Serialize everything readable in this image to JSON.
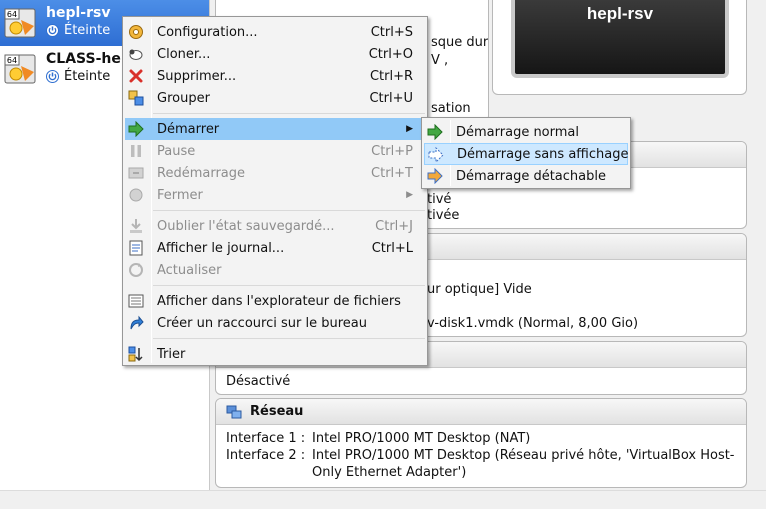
{
  "vm_list": [
    {
      "name": "hepl-rsv",
      "state": "Éteinte",
      "os_badge": "64",
      "selected": true
    },
    {
      "name": "CLASS-hep",
      "state": "Éteinte",
      "os_badge": "64",
      "selected": false
    }
  ],
  "preview": {
    "title": "hepl-rsv"
  },
  "details": {
    "fragments": {
      "f1": "sque dur",
      "f2": "V ,",
      "f3": "sation",
      "f4": "tivé",
      "f5": "tivée",
      "f6": "ur optique] Vide",
      "f7": "v-disk1.vmdk (Normal, 8,00 Gio)",
      "f8": "Désactivé"
    },
    "network": {
      "title": "Réseau",
      "rows": [
        {
          "label": "Interface 1 :",
          "value": "Intel PRO/1000 MT Desktop (NAT)"
        },
        {
          "label": "Interface 2 :",
          "value": "Intel PRO/1000 MT Desktop (Réseau privé hôte, 'VirtualBox Host-"
        },
        {
          "label": "",
          "value": "Only Ethernet Adapter')"
        }
      ]
    }
  },
  "context_menu": {
    "items": [
      {
        "label": "Configuration...",
        "shortcut": "Ctrl+S",
        "icon": "gear-icon"
      },
      {
        "label": "Cloner...",
        "shortcut": "Ctrl+O",
        "icon": "sheep-icon"
      },
      {
        "label": "Supprimer...",
        "shortcut": "Ctrl+R",
        "icon": "delete-icon"
      },
      {
        "label": "Grouper",
        "shortcut": "Ctrl+U",
        "icon": "group-icon"
      },
      {
        "label": "Démarrer",
        "shortcut": "",
        "icon": "start-arrow-icon"
      },
      {
        "label": "Pause",
        "shortcut": "Ctrl+P",
        "icon": "pause-icon"
      },
      {
        "label": "Redémarrage",
        "shortcut": "Ctrl+T",
        "icon": "reset-icon"
      },
      {
        "label": "Fermer",
        "shortcut": "",
        "icon": "close-icon"
      },
      {
        "label": "Oublier l'état sauvegardé...",
        "shortcut": "Ctrl+J",
        "icon": "discard-icon"
      },
      {
        "label": "Afficher le journal...",
        "shortcut": "Ctrl+L",
        "icon": "log-icon"
      },
      {
        "label": "Actualiser",
        "shortcut": "",
        "icon": "refresh-icon"
      },
      {
        "label": "Afficher dans l'explorateur de fichiers",
        "shortcut": "",
        "icon": "file-explorer-icon"
      },
      {
        "label": "Créer un raccourci sur le bureau",
        "shortcut": "",
        "icon": "shortcut-icon"
      },
      {
        "label": "Trier",
        "shortcut": "",
        "icon": "sort-icon"
      }
    ]
  },
  "submenu": {
    "items": [
      {
        "label": "Démarrage normal",
        "icon": "start-normal-icon"
      },
      {
        "label": "Démarrage sans affichage",
        "icon": "start-headless-icon"
      },
      {
        "label": "Démarrage détachable",
        "icon": "start-detachable-icon"
      }
    ]
  },
  "colors": {
    "selection": "#3d7fe0",
    "menu_highlight": "#91c9f7",
    "accent_green": "#3aa23a"
  }
}
